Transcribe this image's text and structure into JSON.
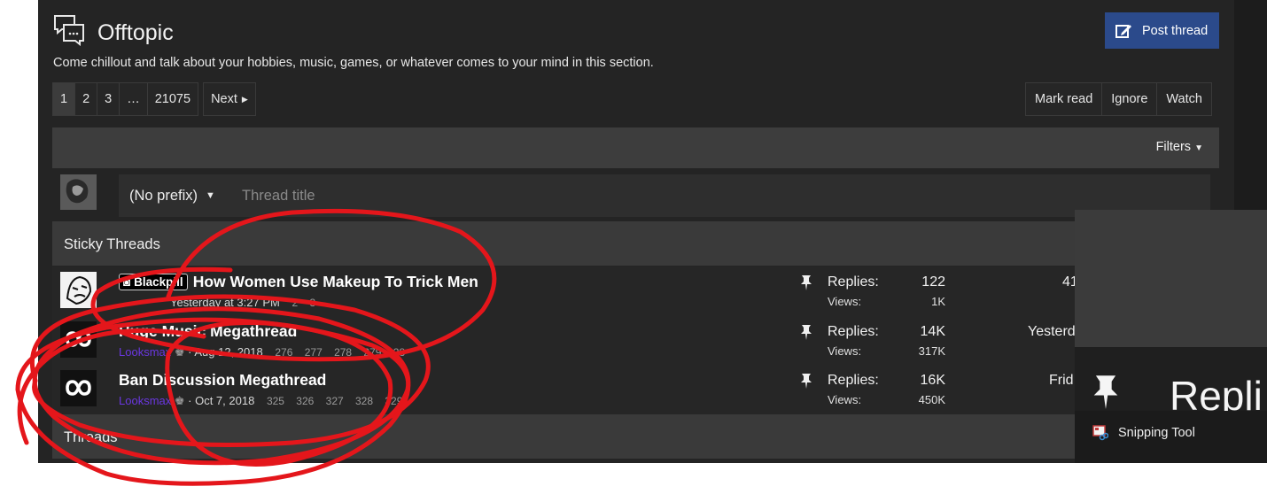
{
  "forum": {
    "title": "Offtopic",
    "description": "Come chillout and talk about your hobbies, music, games, or whatever comes to your mind in this section.",
    "post_thread_label": "Post thread"
  },
  "pagination": {
    "pages": [
      "1",
      "2",
      "3",
      "…",
      "21075"
    ],
    "next_label": "Next",
    "current": "1"
  },
  "forum_actions": {
    "mark_read": "Mark read",
    "ignore": "Ignore",
    "watch": "Watch"
  },
  "filters_label": "Filters",
  "new_thread": {
    "prefix": "(No prefix)",
    "title_placeholder": "Thread title"
  },
  "sections": {
    "sticky": "Sticky Threads",
    "threads": "Threads"
  },
  "sticky_threads": [
    {
      "prefix_badge": "Blackpill",
      "title": "How Women Use Makeup To Trick Men",
      "author": "",
      "date": "Yesterday at 3:27 PM",
      "pages": "2 3",
      "replies_label": "Replies:",
      "replies": "122",
      "views_label": "Views:",
      "views": "1K",
      "last_activity": "41"
    },
    {
      "prefix_badge": "",
      "title": "Huge Music Megathread",
      "author": "Looksmax",
      "date": "· Aug 12, 2018",
      "pages": "276 277 278 279 28",
      "replies_label": "Replies:",
      "replies": "14K",
      "views_label": "Views:",
      "views": "317K",
      "last_activity": "Yesterd"
    },
    {
      "prefix_badge": "",
      "title": "Ban Discussion Megathread",
      "author": "Looksmax",
      "date": "· Oct 7, 2018",
      "pages": "325 326 327 328 329",
      "replies_label": "Replies:",
      "replies": "16K",
      "views_label": "Views:",
      "views": "450K",
      "last_activity": "Frid"
    }
  ],
  "overlay": {
    "zoomed_text": "Repli",
    "taskbar_item": "Snipping Tool"
  },
  "colors": {
    "background": "#242424",
    "accent_button": "#2b4a8b",
    "author_link": "#6a37e0",
    "annotation_stroke": "#e4161b"
  }
}
